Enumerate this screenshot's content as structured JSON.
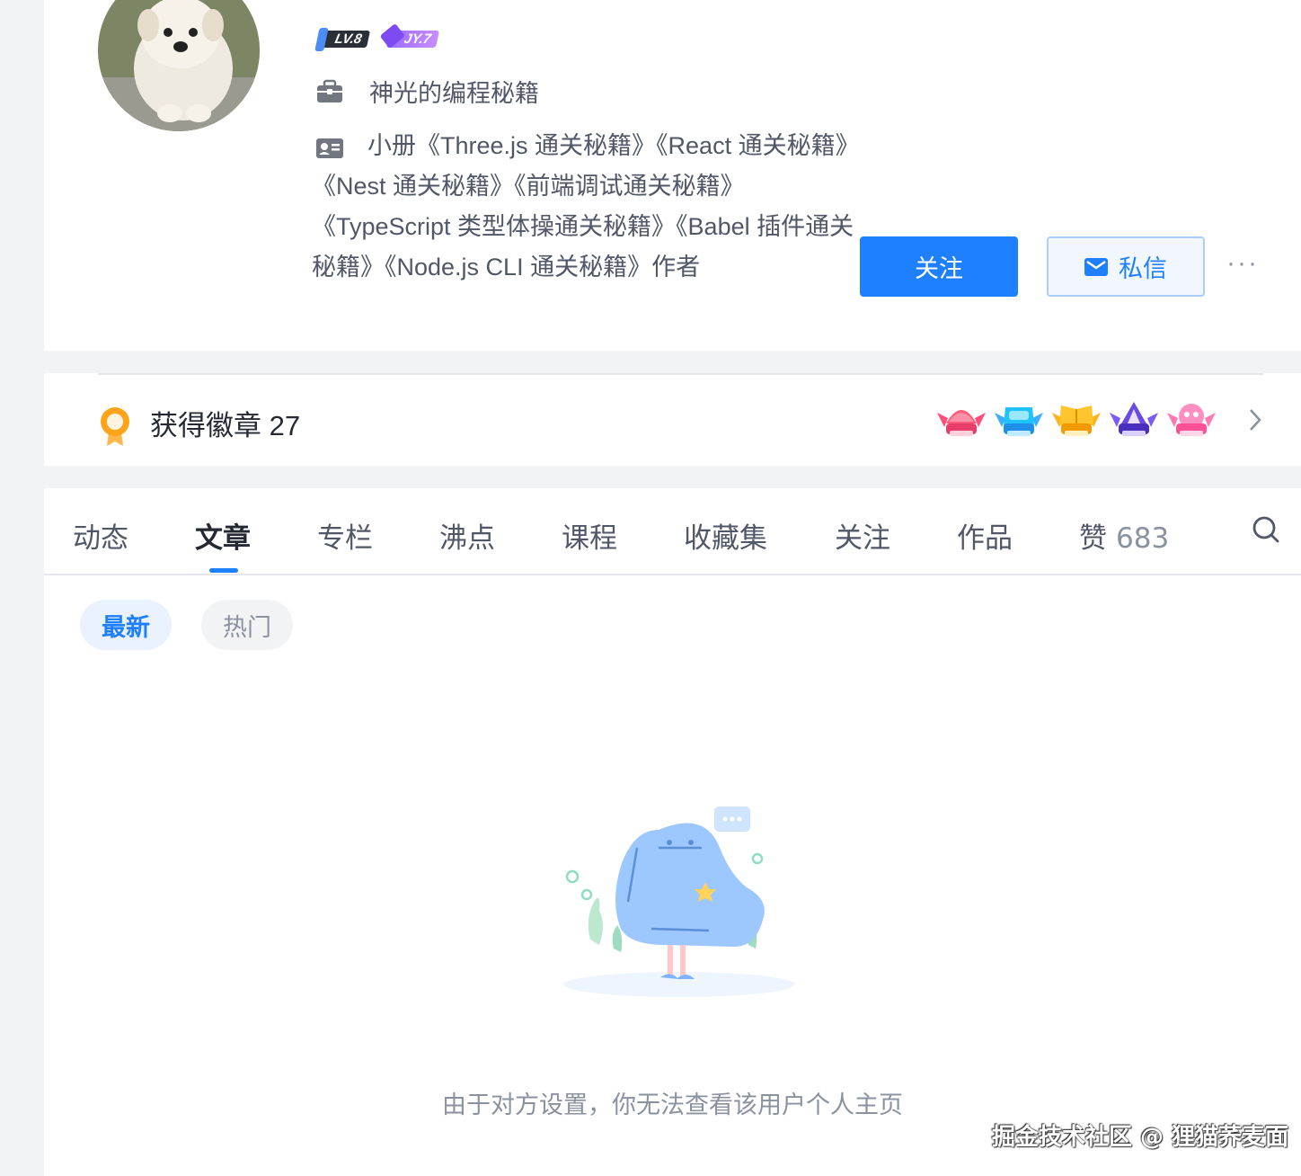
{
  "profile": {
    "level_badge": "LV.8",
    "jy_badge": "JY.7",
    "company": "神光的编程秘籍",
    "bio": "小册《Three.js 通关秘籍》《React 通关秘籍》《Nest 通关秘籍》《前端调试通关秘籍》《TypeScript 类型体操通关秘籍》《Babel 插件通关秘籍》《Node.js CLI 通关秘籍》作者",
    "follow_label": "关注",
    "message_label": "私信",
    "more_label": "···"
  },
  "badges": {
    "label": "获得徽章 27",
    "icons": [
      "watermelon-badge-icon",
      "cloud-badge-icon",
      "book-badge-icon",
      "pen-badge-icon",
      "pink-badge-icon"
    ]
  },
  "tabs": {
    "items": [
      "动态",
      "文章",
      "专栏",
      "沸点",
      "课程",
      "收藏集",
      "关注",
      "作品",
      "赞"
    ],
    "active": "文章",
    "like_count": "683"
  },
  "filters": {
    "latest": "最新",
    "hot": "热门"
  },
  "empty": {
    "message": "由于对方设置，你无法查看该用户个人主页"
  },
  "watermark": "掘金技术社区 @ 狸猫荞麦面",
  "colors": {
    "accent": "#1e80ff",
    "text_primary": "#252933",
    "text_secondary": "#515767",
    "text_muted": "#8a919f",
    "page_bg": "#f2f3f5"
  }
}
